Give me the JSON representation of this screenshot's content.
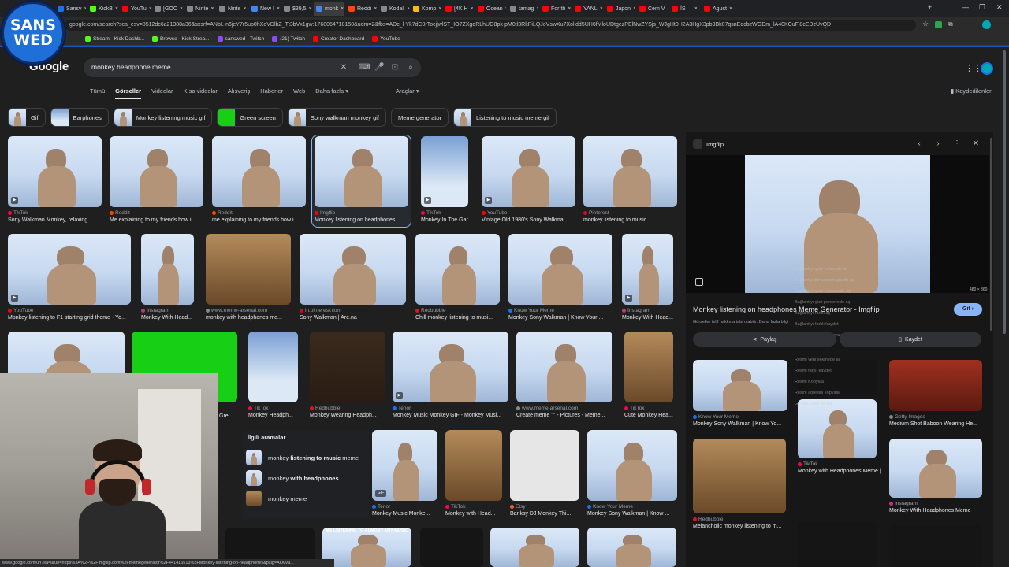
{
  "browser": {
    "tabs": [
      {
        "label": "Sansv",
        "color": "#1a73e8"
      },
      {
        "label": "KickB",
        "color": "#53fc18"
      },
      {
        "label": "YouTu",
        "color": "#ff0000"
      },
      {
        "label": "[GOC",
        "color": "#888888"
      },
      {
        "label": "Ninte",
        "color": "#888888"
      },
      {
        "label": "Ninte",
        "color": "#888888"
      },
      {
        "label": "New I",
        "color": "#4285f4"
      },
      {
        "label": "$39,5",
        "color": "#888888"
      },
      {
        "label": "monk",
        "color": "#4285f4"
      },
      {
        "label": "Reddi",
        "color": "#ff4500"
      },
      {
        "label": "Kodali",
        "color": "#888888"
      },
      {
        "label": "Komp",
        "color": "#fbbc04"
      },
      {
        "label": "[4K H",
        "color": "#ff0000"
      },
      {
        "label": "Ocean",
        "color": "#ff0000"
      },
      {
        "label": "tamag",
        "color": "#888888"
      },
      {
        "label": "For th",
        "color": "#ff0000"
      },
      {
        "label": "YANL",
        "color": "#ff0000"
      },
      {
        "label": "Japon",
        "color": "#ff0000"
      },
      {
        "label": "Cem V",
        "color": "#ff0000"
      },
      {
        "label": "İS",
        "color": "#ff0000"
      },
      {
        "label": "Agust",
        "color": "#ff0000"
      }
    ],
    "active_tab": 8,
    "url": "google.com/search?sca_esv=8512dc6a21388a36&sxsrf=ANbL-n6jeY7r5up0hXoVDlbZ_Tt3bVx1gw:1768054718150&udm=2&fbs=ADc_l-Yk7dC9rTocjjwlST_IO7ZXgdRLhUG8pk-pM0tl3RkPiLQJoVswXu7Xolldd5UH6fMloUDtgezPElNwZYSjs_WJgHt0H2A3HgX3pb3Bk07qsnEqdszWGDm_lA40KCuFl8cEDzUvQD",
    "bookmarks": [
      "Stream - Kick Dashb...",
      "Browse - Kick Strea...",
      "sanswed - Twitch",
      "(21) Twitch",
      "Creator Dashboard",
      "YouTube"
    ]
  },
  "logo_text": {
    "line1": "SANS",
    "line2": "WED"
  },
  "google": {
    "logo": "Google",
    "query": "monkey headphone meme",
    "nav": [
      "Tümü",
      "Görseller",
      "Videolar",
      "Kısa videolar",
      "Alışveriş",
      "Haberler",
      "Web",
      "Daha fazla ▾"
    ],
    "tools": "Araçlar ▾",
    "saved": "Kaydedilenler"
  },
  "chips": [
    "Gif",
    "Earphones",
    "Monkey listening music gif",
    "Green screen",
    "Sony walkman monkey gif",
    "Meme generator",
    "Listening to music meme gif"
  ],
  "results": [
    {
      "src": "TikTok",
      "title": "Sony Walkman Monkey, relaxing...",
      "color": "#ff0050",
      "play": true
    },
    {
      "src": "Reddit",
      "title": "Me explaining to my friends how i...",
      "color": "#ff4500"
    },
    {
      "src": "Reddit",
      "title": "me explaining to my friends how i ...",
      "color": "#ff4500"
    },
    {
      "src": "Imgflip",
      "title": "Monkey listening on headphones ...",
      "color": "#ff0000"
    },
    {
      "src": "TikTok",
      "title": "Monkey In The Gar...",
      "color": "#ff0050",
      "play": true
    },
    {
      "src": "YouTube",
      "title": "Vintage Old 1980's Sony Walkma...",
      "color": "#ff0000",
      "play": true
    },
    {
      "src": "Pinterest",
      "title": "monkey listening to music",
      "color": "#e60023"
    },
    {
      "src": "YouTube",
      "title": "Monkey listening to F1 starting grid theme - Yo...",
      "color": "#ff0000",
      "play": true
    },
    {
      "src": "Instagram",
      "title": "Monkey With Head...",
      "color": "#c13584"
    },
    {
      "src": "www.meme-arsenal.com",
      "title": "monkey with headphones me...",
      "color": "#888888"
    },
    {
      "src": "in.pinterest.com",
      "title": "Sony Walkman | Are.na",
      "color": "#e60023"
    },
    {
      "src": "Redbubble",
      "title": "Chill monkey listening to musi...",
      "color": "#e41321"
    },
    {
      "src": "Know Your Meme",
      "title": "Monkey Sony Walkman | Know Your ...",
      "color": "#1a73e8"
    },
    {
      "src": "Instagram",
      "title": "Monkey With Head...",
      "color": "#c13584",
      "play": true
    },
    {
      "src": "TikTok",
      "title": "Monkey Headph...",
      "color": "#ff0050"
    },
    {
      "src": "Redbubble",
      "title": "Monkey Wearing Headph...",
      "color": "#e41321"
    },
    {
      "src": "Tenor",
      "title": "Monkey Music Monkey GIF - Monkey Musi...",
      "color": "#1a73e8",
      "play": true
    },
    {
      "src": "www.meme-arsenal.com",
      "title": "Create meme \"\" - Pictures - Meme...",
      "color": "#888888"
    },
    {
      "src": "TikTok",
      "title": "Cute Monkey Hea...",
      "color": "#ff0050"
    },
    {
      "src": "Tenor",
      "title": "Monkey Music Monke...",
      "color": "#1a73e8"
    },
    {
      "src": "TikTok",
      "title": "Monkey with Head...",
      "color": "#ff0050"
    },
    {
      "src": "Etsy",
      "title": "Banksy DJ Monkey Thi...",
      "color": "#f1641e"
    },
    {
      "src": "Know Your Meme",
      "title": "Monkey Sony Walkman | Know ...",
      "color": "#1a73e8"
    }
  ],
  "cut_caption": "Gre...",
  "related": {
    "heading": "İlgili aramalar",
    "items": [
      {
        "pre": "monkey ",
        "bold": "listening to music",
        "post": " meme"
      },
      {
        "pre": "monkey ",
        "bold": "with headphones",
        "post": ""
      },
      {
        "pre": "monkey meme",
        "bold": "",
        "post": ""
      }
    ]
  },
  "bottom_strip": {
    "text1": "ME LISTENING TO ALMOST ANY MUSIC",
    "gif": "GIF"
  },
  "panel": {
    "source": "Imgflip",
    "title": "Monkey listening on headphones Meme Generator - Imgflip",
    "go": "Git ›",
    "note": "Görseller telif hakkına tabi olabilir. Daha fazla bilgi",
    "share": "Paylaş",
    "save": "Kaydet",
    "dims": "480 × 360",
    "context_menu": [
      "Bağlantıyı yeni sekmede aç",
      "Bağlantıyı bir sonraki grupta aç",
      "Bağlantıyı yeni pencerede aç",
      "Bağlantıyı gizli pencerede aç",
      "Bağlantıyı farklı aç",
      "Bağlantıyı farklı kaydet",
      "Bağlantı adresini kopyala"
    ],
    "context_menu2": [
      "Resmi yeni sekmede aç",
      "Resmi farklı kaydet",
      "Resmi Kopyala",
      "Resim adresini kopyala",
      "Google Lens ile ara"
    ],
    "related": [
      {
        "src": "Know Your Meme",
        "title": "Monkey Sony Walkman | Know Yo...",
        "color": "#1a73e8"
      },
      {
        "src": "Getty Images",
        "title": "Medium Shot Baboon Wearing He...",
        "color": "#888888"
      },
      {
        "src": "TikTok",
        "title": "Monkey with Headphones Meme | ...",
        "color": "#ff0050"
      },
      {
        "src": "Redbubble",
        "title": "Melancholic monkey listening to m...",
        "color": "#e41321"
      },
      {
        "src": "Instagram",
        "title": "Monkey With Headphones Meme",
        "color": "#c13584"
      }
    ]
  },
  "status_url": "www.google.com/url?sa=i&url=https%3A%2F%2Fimgflip.com%2Fmemegenerator%2F441416513%2FMonkey-listening-on-headphones&psig=AOvVa..."
}
